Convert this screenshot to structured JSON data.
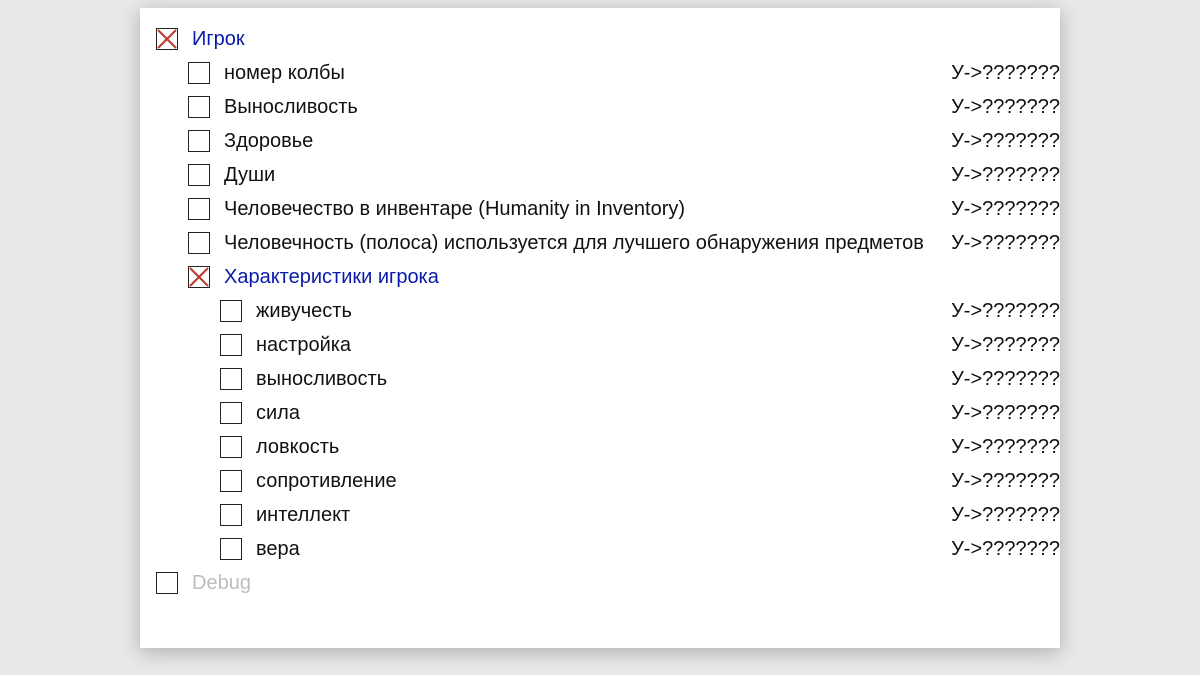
{
  "value_placeholder": "У->???????",
  "tree": {
    "player": {
      "label": "Игрок",
      "checked": true,
      "items": [
        {
          "label": "номер колбы"
        },
        {
          "label": "Выносливость"
        },
        {
          "label": "Здоровье"
        },
        {
          "label": "Души"
        },
        {
          "label": "Человечество в инвентаре (Humanity in Inventory)"
        },
        {
          "label": "Человечность (полоса) используется для лучшего обнаружения предметов"
        }
      ],
      "stats": {
        "label": "Характеристики игрока",
        "checked": true,
        "items": [
          {
            "label": "живучесть"
          },
          {
            "label": "настройка"
          },
          {
            "label": "выносливость"
          },
          {
            "label": "сила"
          },
          {
            "label": "ловкость"
          },
          {
            "label": "сопротивление"
          },
          {
            "label": "интеллект"
          },
          {
            "label": "вера"
          }
        ]
      }
    },
    "debug": {
      "label": "Debug",
      "checked": false
    }
  }
}
